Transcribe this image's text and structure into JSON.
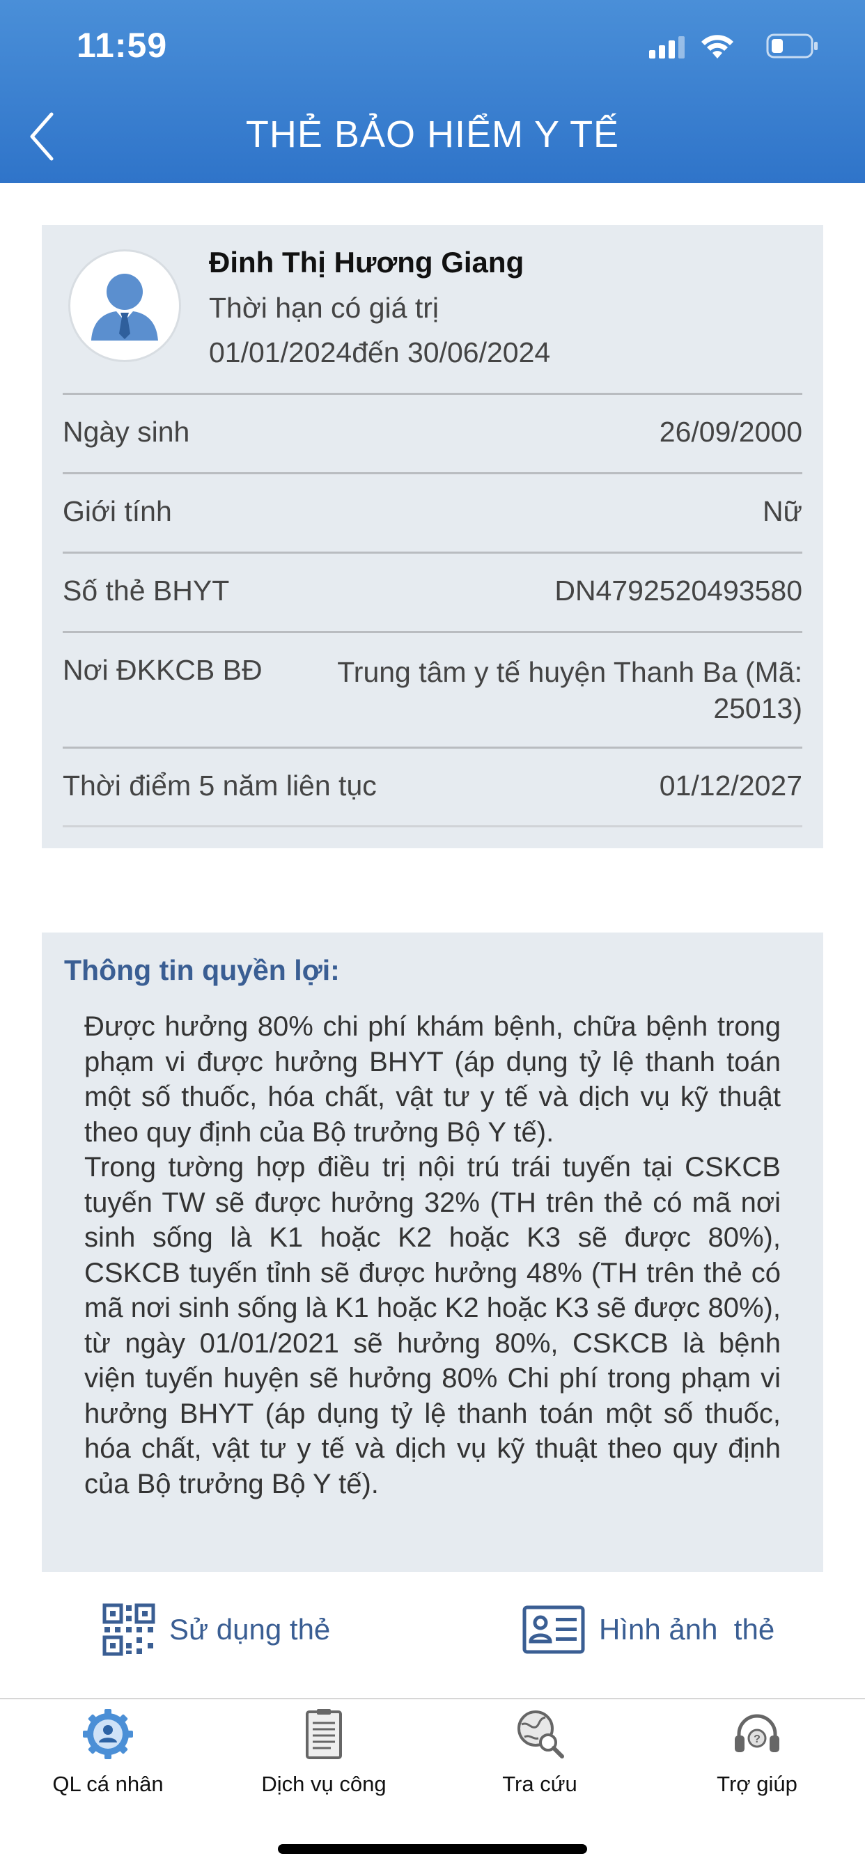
{
  "status_bar": {
    "time": "11:59"
  },
  "header": {
    "title": "THẺ BẢO HIỂM Y TẾ"
  },
  "card": {
    "name": "Đinh Thị Hương Giang",
    "validity_label": "Thời hạn có giá trị",
    "validity_range": "01/01/2024đến 30/06/2024",
    "rows": [
      {
        "label": "Ngày sinh",
        "value": "26/09/2000"
      },
      {
        "label": "Giới tính",
        "value": "Nữ"
      },
      {
        "label": "Số thẻ BHYT",
        "value": "DN4792520493580"
      },
      {
        "label": "Nơi ĐKKCB BĐ",
        "value": "Trung tâm y tế huyện Thanh Ba (Mã: 25013)"
      },
      {
        "label": "Thời điểm 5 năm liên tục",
        "value": "01/12/2027"
      }
    ]
  },
  "benefits": {
    "title": "Thông tin quyền lợi:",
    "paragraph1": "Được hưởng 80% chi phí khám bệnh, chữa bệnh trong phạm vi được hưởng BHYT (áp dụng tỷ lệ thanh toán một số thuốc, hóa chất, vật tư y tế và dịch vụ kỹ thuật theo quy định của Bộ trưởng Bộ Y tế).",
    "paragraph2": "Trong tường hợp điều trị nội trú trái tuyến tại CSKCB tuyến TW sẽ được hưởng 32% (TH trên thẻ có mã nơi sinh sống là K1 hoặc K2 hoặc K3 sẽ được 80%), CSKCB tuyến tỉnh sẽ được hưởng 48% (TH trên thẻ có mã nơi sinh sống là K1 hoặc K2 hoặc K3 sẽ được 80%), từ ngày 01/01/2021 sẽ hưởng 80%, CSKCB là bệnh viện tuyến huyện sẽ hưởng 80% Chi phí trong phạm vi hưởng BHYT (áp dụng tỷ lệ thanh toán một số thuốc, hóa chất, vật tư y tế và dịch vụ kỹ thuật theo quy định của Bộ trưởng Bộ Y tế)."
  },
  "actions": {
    "use_card": "Sử dụng thẻ",
    "card_image": "Hình ảnh  thẻ"
  },
  "bottom_nav": [
    {
      "label": "QL cá nhân",
      "icon": "personal-gear-icon"
    },
    {
      "label": "Dịch vụ công",
      "icon": "document-icon"
    },
    {
      "label": "Tra cứu",
      "icon": "globe-search-icon"
    },
    {
      "label": "Trợ giúp",
      "icon": "headset-icon"
    }
  ],
  "colors": {
    "header_top": "#4a8fd8",
    "header_bottom": "#2f74c9",
    "card_bg": "#e6ebf0",
    "accent": "#3a5e93"
  }
}
